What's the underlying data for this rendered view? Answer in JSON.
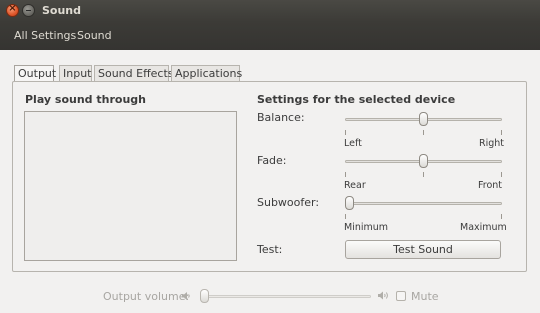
{
  "window": {
    "title": "Sound"
  },
  "toolbar": {
    "all_settings": "All Settings",
    "sound": "Sound"
  },
  "tabs": [
    {
      "label": "Output",
      "active": true
    },
    {
      "label": "Input",
      "active": false
    },
    {
      "label": "Sound Effects",
      "active": false
    },
    {
      "label": "Applications",
      "active": false
    }
  ],
  "output": {
    "play_through_heading": "Play sound through",
    "device_settings_heading": "Settings for the selected device",
    "balance": {
      "label": "Balance:",
      "left": "Left",
      "right": "Right",
      "value": 0.5
    },
    "fade": {
      "label": "Fade:",
      "left": "Rear",
      "right": "Front",
      "value": 0.5
    },
    "subwoofer": {
      "label": "Subwoofer:",
      "left": "Minimum",
      "right": "Maximum",
      "value": 0.0
    },
    "test": {
      "label": "Test:",
      "button": "Test Sound"
    }
  },
  "bottom": {
    "volume_label": "Output volume:",
    "volume_value": 0.0,
    "mute_label": "Mute",
    "mute_checked": false
  },
  "icons": {
    "close": "close-icon",
    "minimize": "minimize-icon",
    "speaker_low": "speaker-low-icon",
    "speaker_high": "speaker-high-icon"
  }
}
